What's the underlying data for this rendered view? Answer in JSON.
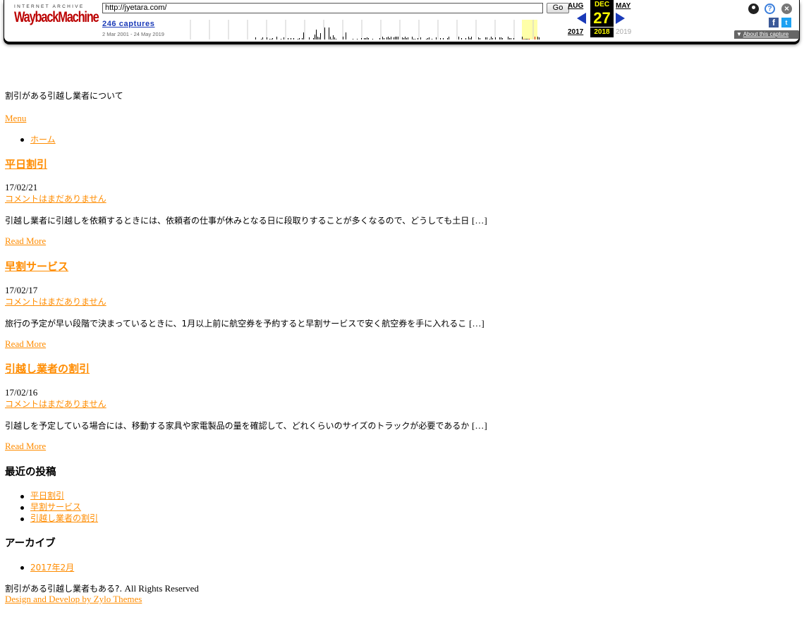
{
  "wayback": {
    "logo_top": "INTERNET ARCHIVE",
    "logo_main_a": "Wayback",
    "logo_main_b": "Machine",
    "url": "http://jyetara.com/",
    "go_label": "Go",
    "captures": "246 captures",
    "range": "2 Mar 2001 - 24 May 2019",
    "prev_month": "AUG",
    "cur_month": "DEC",
    "next_month": "MAY",
    "day": "27",
    "prev_year": "2017",
    "cur_year": "2018",
    "next_year": "2019",
    "about": "About this capture",
    "accent": "#1a3ab8",
    "highlight": "#ffff00"
  },
  "site": {
    "description": "割引がある引越し業者について",
    "menu_label": "Menu",
    "nav": [
      "ホーム"
    ]
  },
  "posts": [
    {
      "title": "平日割引",
      "date": "17/02/21",
      "comments": "コメントはまだありません",
      "excerpt": "引越し業者に引越しを依頼するときには、依頼者の仕事が休みとなる日に段取りすることが多くなるので、どうしても土日",
      "more": "[…]",
      "read_more": "Read More"
    },
    {
      "title": "早割サービス",
      "date": "17/02/17",
      "comments": "コメントはまだありません",
      "excerpt": "旅行の予定が早い段階で決まっているときに、1月以上前に航空券を予約すると早割サービスで安く航空券を手に入れるこ",
      "more": "[…]",
      "read_more": "Read More"
    },
    {
      "title": "引越し業者の割引",
      "date": "17/02/16",
      "comments": "コメントはまだありません",
      "excerpt": "引越しを予定している場合には、移動する家具や家電製品の量を確認して、どれくらいのサイズのトラックが必要であるか",
      "more": "[…]",
      "read_more": "Read More"
    }
  ],
  "sidebar": {
    "recent_title": "最近の投稿",
    "recent": [
      "平日割引",
      "早割サービス",
      "引越し業者の割引"
    ],
    "archive_title": "アーカイブ",
    "archives": [
      "2017年2月"
    ]
  },
  "footer": {
    "copy_jp": "割引がある引越し業者もある?.",
    "copy_en": "All Rights Reserved",
    "credit": "Design and Develop by Zylo Themes"
  },
  "colors": {
    "link": "#ff8c00",
    "brand_red": "#bb0000"
  }
}
